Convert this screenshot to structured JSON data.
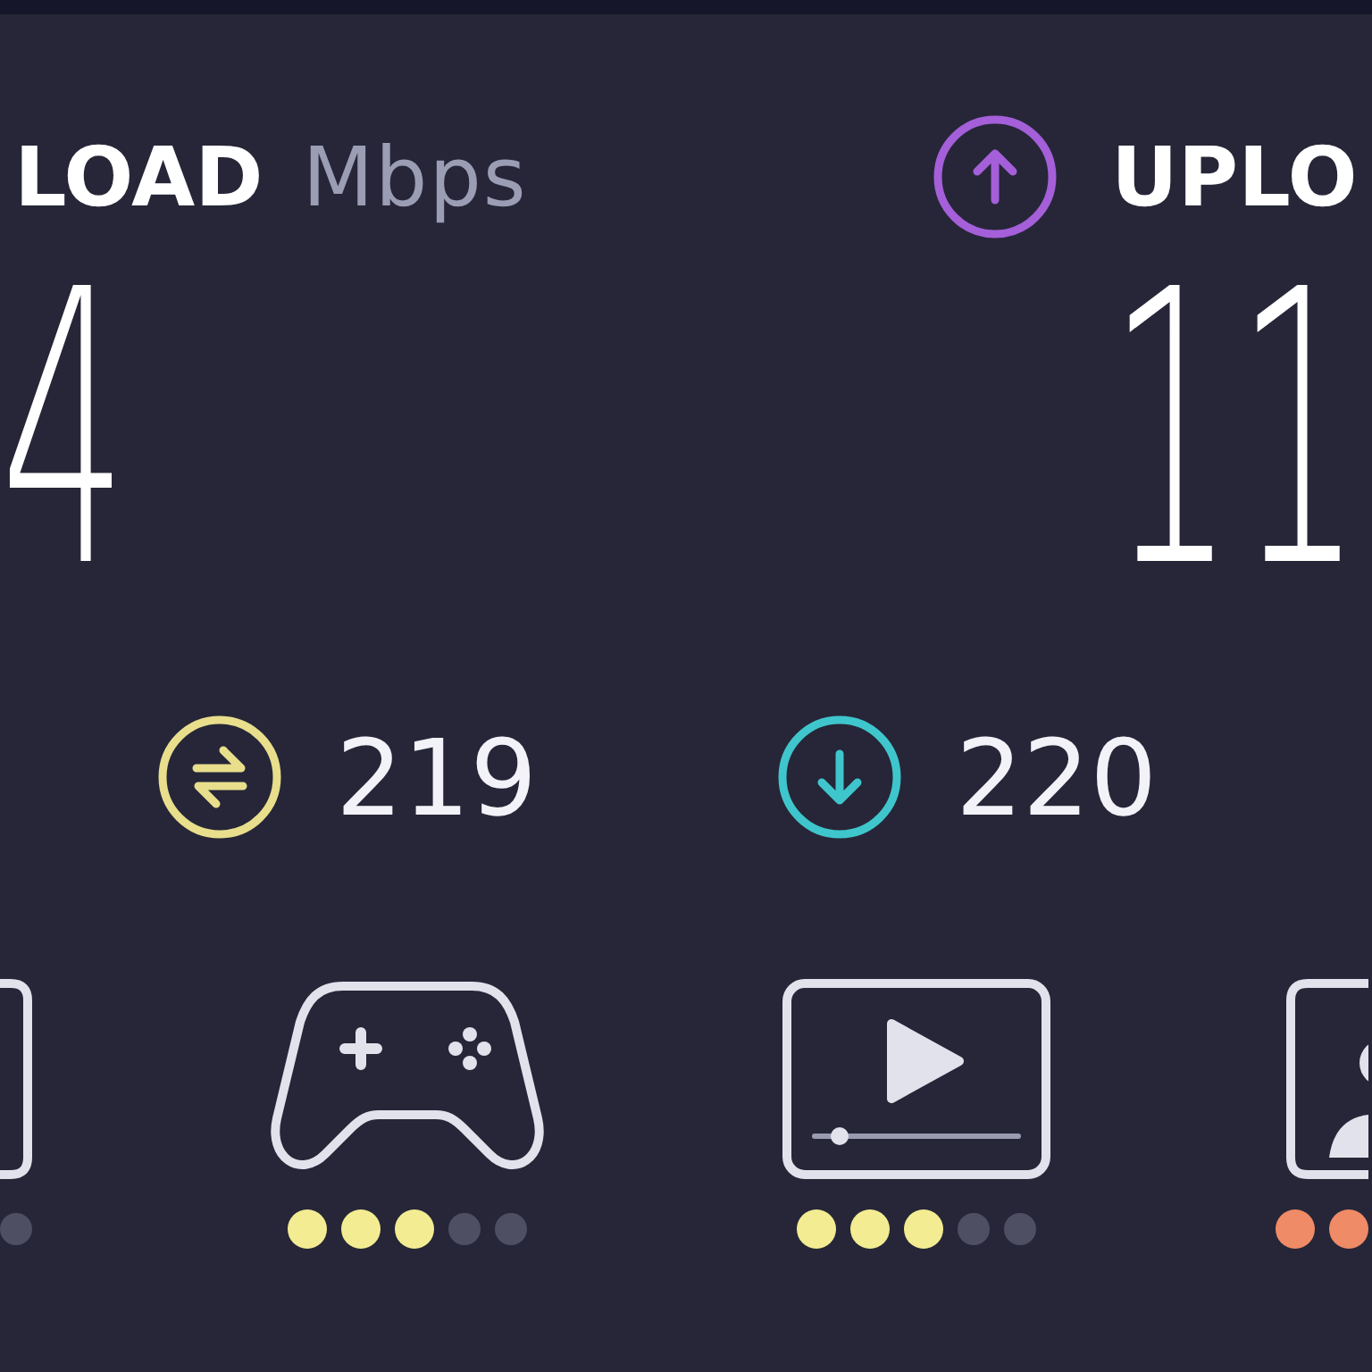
{
  "results": [
    {
      "kind": "download",
      "label": "LOAD",
      "unit": "Mbps",
      "value": "4"
    },
    {
      "kind": "upload",
      "label": "UPLO",
      "color": "#a45fd9",
      "value": "11"
    }
  ],
  "latency": [
    {
      "kind": "idle",
      "color": "#e8de8c",
      "value": "219"
    },
    {
      "kind": "download",
      "color": "#3fc6cc",
      "value": "220"
    }
  ],
  "activities": [
    {
      "kind": "frame",
      "dots": [
        {
          "filled": false
        }
      ]
    },
    {
      "kind": "gaming",
      "color": "#f3ec92",
      "dots": [
        {
          "filled": true
        },
        {
          "filled": true
        },
        {
          "filled": true
        },
        {
          "filled": false
        },
        {
          "filled": false
        }
      ]
    },
    {
      "kind": "video",
      "color": "#f3ec92",
      "dots": [
        {
          "filled": true
        },
        {
          "filled": true
        },
        {
          "filled": true
        },
        {
          "filled": false
        },
        {
          "filled": false
        }
      ]
    },
    {
      "kind": "video_call",
      "color": "#ef8b66",
      "dots": [
        {
          "filled": true
        },
        {
          "filled": true
        }
      ]
    }
  ]
}
